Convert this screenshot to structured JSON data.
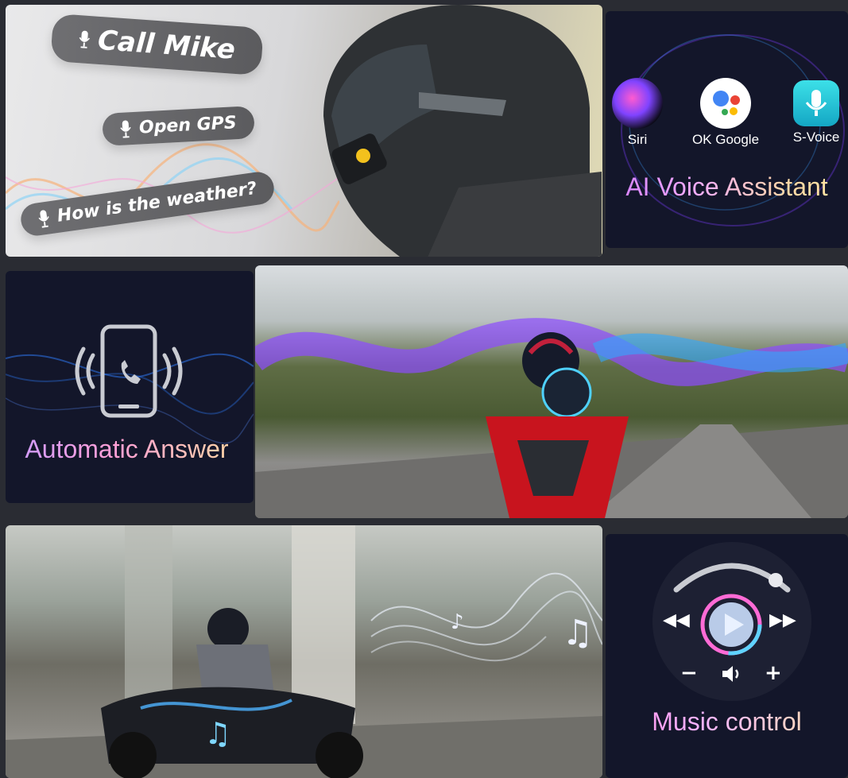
{
  "voice_commands": {
    "call": "Call Mike",
    "gps": "Open GPS",
    "weather": "How is the weather?"
  },
  "assistant": {
    "items": [
      {
        "label": "Siri",
        "icon": "siri-icon"
      },
      {
        "label": "OK Google",
        "icon": "google-assistant-icon"
      },
      {
        "label": "S-Voice",
        "icon": "s-voice-icon"
      }
    ],
    "title": "AI Voice Assistant"
  },
  "answer": {
    "icon": "phone-ringing-icon",
    "title": "Automatic Answer"
  },
  "music": {
    "title": "Music control",
    "minus": "−",
    "plus": "+",
    "icons": [
      "rewind-icon",
      "play-icon",
      "fast-forward-icon",
      "volume-icon"
    ]
  },
  "colors": {
    "panel_dark": "#13162a",
    "accent_purple": "#b57bff",
    "accent_gold": "#ffd8a6",
    "wave_blue": "#3b8bff"
  }
}
